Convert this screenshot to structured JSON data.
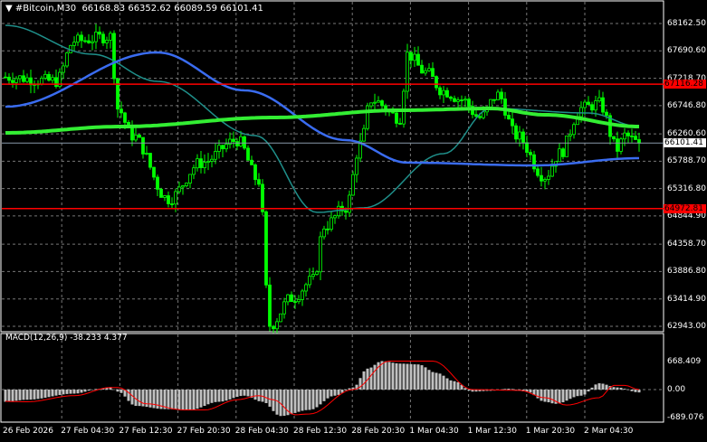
{
  "header": {
    "symbol": "#Bitcoin,M30",
    "ohlc": "66168.83 66352.62 66089.59 66101.41"
  },
  "colors": {
    "bg": "#000000",
    "candle": "#00ff00",
    "ma_fast": "#3a6cf0",
    "ma_mid": "#1f8f8a",
    "ma_slow": "#33ee33",
    "level": "#ff0000",
    "macd_hist": "#c0c0c0",
    "macd_signal": "#ff0000"
  },
  "price_axis": {
    "max": 68162.5,
    "min": 62943.0,
    "labels": [
      "68162.50",
      "67690.60",
      "67218.70",
      "66746.80",
      "66260.60",
      "65788.70",
      "65316.80",
      "64844.90",
      "64358.70",
      "63886.80",
      "63414.90",
      "62943.00"
    ]
  },
  "levels": [
    {
      "value": 67116.28,
      "label": "67116.28"
    },
    {
      "value": 64972.81,
      "label": "64972.81"
    }
  ],
  "current_price": {
    "value": 66101.41,
    "label": "66101.41"
  },
  "price_path": [
    [
      0,
      67240
    ],
    [
      14,
      67170
    ],
    [
      19,
      67860
    ],
    [
      29,
      67940
    ],
    [
      31,
      66700
    ],
    [
      35,
      66230
    ],
    [
      45,
      65140
    ],
    [
      54,
      65760
    ],
    [
      64,
      66150
    ],
    [
      70,
      65450
    ],
    [
      73,
      62960
    ],
    [
      79,
      63430
    ],
    [
      85,
      63740
    ],
    [
      88,
      64670
    ],
    [
      94,
      64990
    ],
    [
      98,
      66080
    ],
    [
      101,
      66850
    ],
    [
      109,
      66540
    ],
    [
      111,
      67630
    ],
    [
      116,
      67320
    ],
    [
      121,
      67000
    ],
    [
      126,
      66850
    ],
    [
      131,
      66540
    ],
    [
      136,
      66930
    ],
    [
      141,
      66230
    ],
    [
      149,
      65530
    ],
    [
      153,
      65920
    ],
    [
      159,
      66700
    ],
    [
      164,
      66780
    ],
    [
      169,
      66000
    ],
    [
      171,
      66230
    ],
    [
      175,
      66101
    ]
  ],
  "ma_slow": [
    [
      0,
      66277
    ],
    [
      32,
      66386
    ],
    [
      74,
      66542
    ],
    [
      109,
      66667
    ],
    [
      134,
      66698
    ],
    [
      149,
      66589
    ],
    [
      175,
      66386
    ]
  ],
  "ma_fast": [
    [
      0,
      66729
    ],
    [
      42,
      67664
    ],
    [
      66,
      67010
    ],
    [
      94,
      66153
    ],
    [
      111,
      65764
    ],
    [
      146,
      65716
    ],
    [
      175,
      65841
    ]
  ],
  "ma_mid": [
    [
      0,
      68131
    ],
    [
      24,
      67633
    ],
    [
      42,
      67166
    ],
    [
      69,
      66231
    ],
    [
      86,
      64907
    ],
    [
      99,
      64985
    ],
    [
      121,
      65919
    ],
    [
      134,
      66698
    ],
    [
      161,
      66620
    ],
    [
      175,
      66386
    ]
  ],
  "macd": {
    "label": "MACD(12,26,9) -38.233 4.377",
    "max_label": "668.409",
    "zero_label": "0.00",
    "min_label": "-689.076",
    "max": 668.409,
    "min": -689.076,
    "hist": [
      [
        0,
        -300
      ],
      [
        6,
        -250
      ],
      [
        19,
        -100
      ],
      [
        26,
        20
      ],
      [
        29,
        60
      ],
      [
        31,
        -50
      ],
      [
        36,
        -400
      ],
      [
        44,
        -480
      ],
      [
        51,
        -500
      ],
      [
        59,
        -300
      ],
      [
        66,
        -150
      ],
      [
        71,
        -300
      ],
      [
        76,
        -650
      ],
      [
        84,
        -500
      ],
      [
        91,
        -150
      ],
      [
        96,
        50
      ],
      [
        100,
        500
      ],
      [
        104,
        680
      ],
      [
        109,
        620
      ],
      [
        114,
        600
      ],
      [
        119,
        400
      ],
      [
        124,
        200
      ],
      [
        129,
        -50
      ],
      [
        134,
        -30
      ],
      [
        139,
        20
      ],
      [
        144,
        -50
      ],
      [
        149,
        -300
      ],
      [
        152,
        -350
      ],
      [
        159,
        -150
      ],
      [
        164,
        150
      ],
      [
        169,
        50
      ],
      [
        175,
        -70
      ]
    ],
    "signal": [
      [
        0,
        -290
      ],
      [
        6,
        -300
      ],
      [
        19,
        -150
      ],
      [
        29,
        50
      ],
      [
        31,
        50
      ],
      [
        39,
        -350
      ],
      [
        49,
        -500
      ],
      [
        55,
        -500
      ],
      [
        64,
        -250
      ],
      [
        70,
        -150
      ],
      [
        74,
        -250
      ],
      [
        80,
        -620
      ],
      [
        84,
        -600
      ],
      [
        96,
        0
      ],
      [
        106,
        680
      ],
      [
        118,
        680
      ],
      [
        129,
        0
      ],
      [
        142,
        -20
      ],
      [
        149,
        -200
      ],
      [
        155,
        -380
      ],
      [
        164,
        -200
      ],
      [
        168,
        100
      ],
      [
        171,
        100
      ],
      [
        175,
        0
      ]
    ]
  },
  "time_axis": [
    "26 Feb 2026",
    "27 Feb 04:30",
    "27 Feb 12:30",
    "27 Feb 20:30",
    "28 Feb 04:30",
    "28 Feb 12:30",
    "28 Feb 20:30",
    "1 Mar 04:30",
    "1 Mar 12:30",
    "1 Mar 20:30",
    "2 Mar 04:30"
  ]
}
